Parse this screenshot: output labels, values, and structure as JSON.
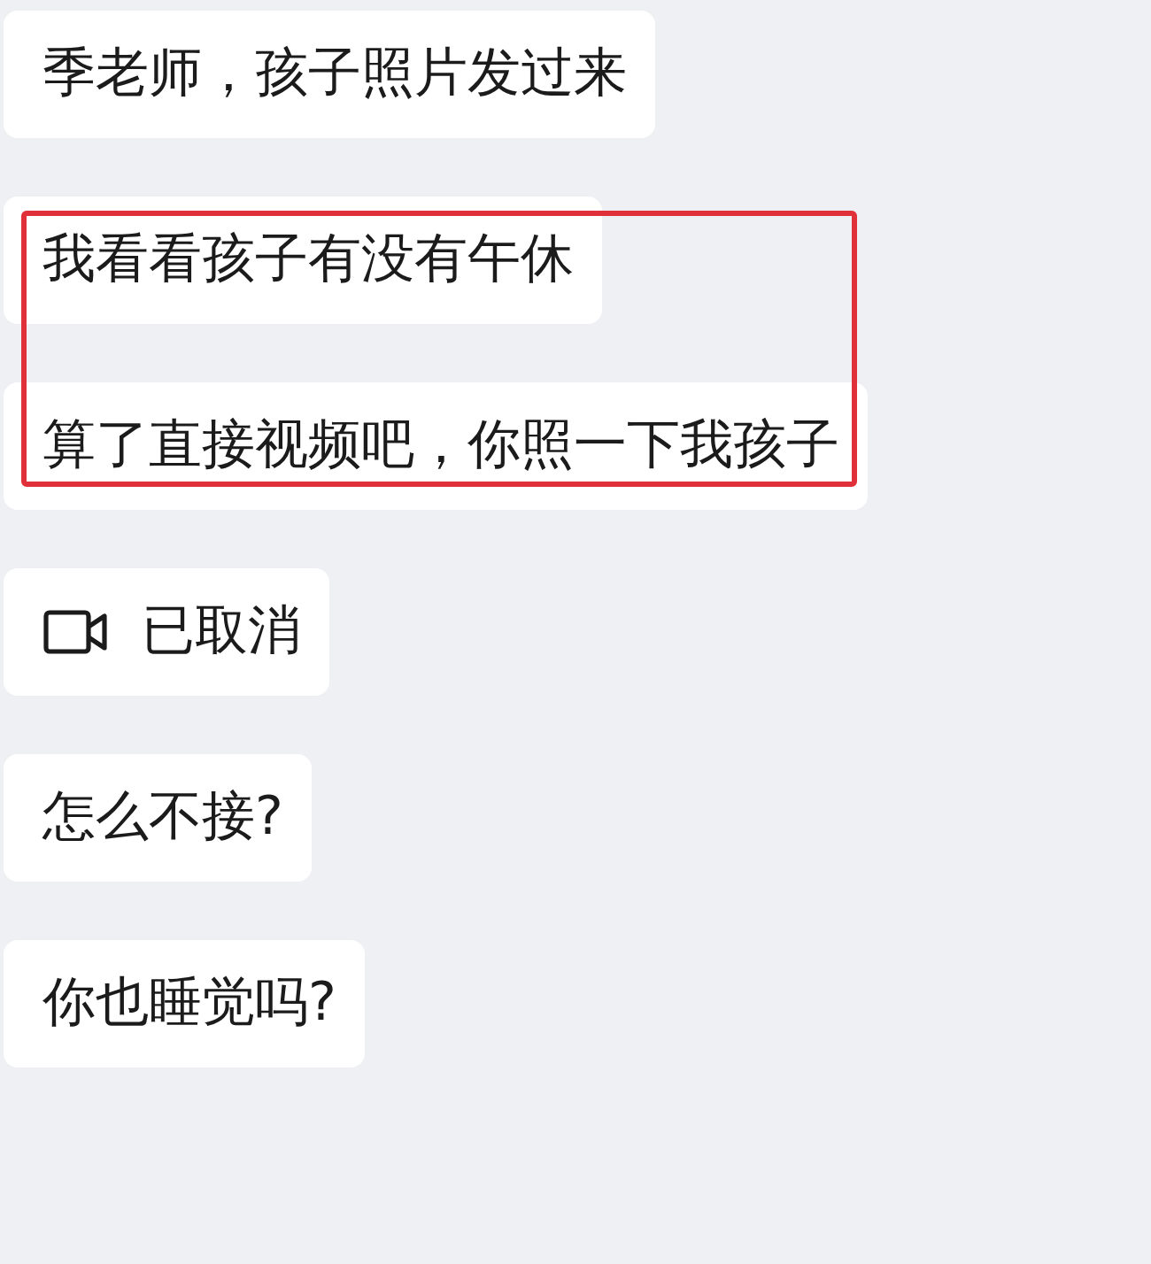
{
  "messages": [
    {
      "kind": "text",
      "text": "季老师，孩子照片发过来",
      "highlighted": false
    },
    {
      "kind": "text",
      "text": "我看看孩子有没有午休",
      "highlighted": true
    },
    {
      "kind": "text",
      "text": "算了直接视频吧，你照一下我孩子",
      "highlighted": true
    },
    {
      "kind": "video-call",
      "text": "已取消",
      "highlighted": false
    },
    {
      "kind": "text",
      "text": "怎么不接?",
      "highlighted": false
    },
    {
      "kind": "text",
      "text": "你也睡觉吗?",
      "highlighted": false
    }
  ]
}
